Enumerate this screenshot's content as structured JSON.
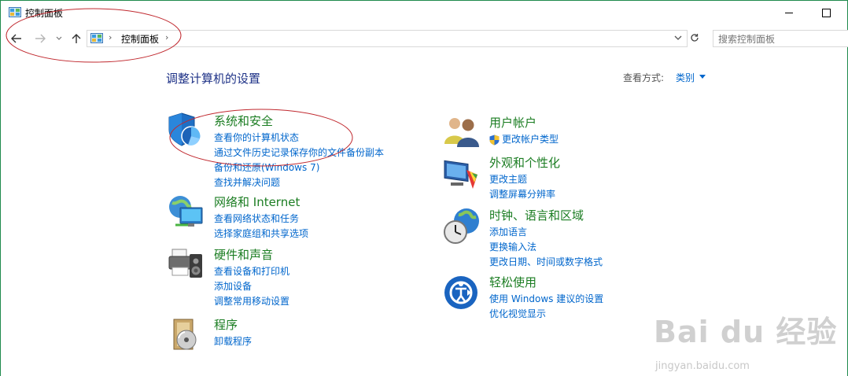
{
  "window": {
    "title": "控制面板"
  },
  "address": {
    "crumb": "控制面板"
  },
  "search": {
    "placeholder": "搜索控制面板"
  },
  "header": {
    "title": "调整计算机的设置",
    "view_label": "查看方式:",
    "view_value": "类别"
  },
  "categories": [
    {
      "title": "系统和安全",
      "icon": "shield-icon",
      "links": [
        "查看你的计算机状态",
        "通过文件历史记录保存你的文件备份副本",
        "备份和还原(Windows 7)",
        "查找并解决问题"
      ]
    },
    {
      "title": "网络和 Internet",
      "icon": "network-globe-icon",
      "links": [
        "查看网络状态和任务",
        "选择家庭组和共享选项"
      ]
    },
    {
      "title": "硬件和声音",
      "icon": "printer-speaker-icon",
      "links": [
        "查看设备和打印机",
        "添加设备",
        "调整常用移动设置"
      ]
    },
    {
      "title": "程序",
      "icon": "programs-disc-icon",
      "links": [
        "卸载程序"
      ]
    },
    {
      "title": "用户帐户",
      "icon": "users-icon",
      "links": [
        "更改帐户类型"
      ]
    },
    {
      "title": "外观和个性化",
      "icon": "monitor-palette-icon",
      "links": [
        "更改主题",
        "调整屏幕分辨率"
      ]
    },
    {
      "title": "时钟、语言和区域",
      "icon": "clock-globe-icon",
      "links": [
        "添加语言",
        "更换输入法",
        "更改日期、时间或数字格式"
      ]
    },
    {
      "title": "轻松使用",
      "icon": "ease-of-access-icon",
      "links": [
        "使用 Windows 建议的设置",
        "优化视觉显示"
      ]
    }
  ],
  "watermark": {
    "brand": "Bai du 经验",
    "url": "jingyan.baidu.com"
  },
  "colors": {
    "link": "#0066cc",
    "category_title": "#1b7d22",
    "heading": "#1e3287",
    "annotation": "#c0282e"
  }
}
